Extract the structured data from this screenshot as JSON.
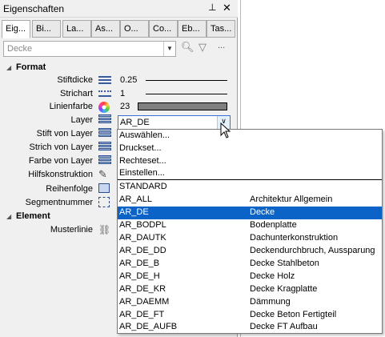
{
  "panel": {
    "title": "Eigenschaften",
    "pin_glyph": "⊥",
    "close_glyph": "✕",
    "tabs": [
      "Eig...",
      "Bi...",
      "La...",
      "As...",
      "O...",
      "Co...",
      "Eb...",
      "Tas..."
    ],
    "active_tab_index": 0,
    "filter_placeholder": "Decke",
    "tools": {
      "find_icon": "magnifier-icon",
      "filter_icon": "funnel-icon",
      "more_label": "..."
    }
  },
  "groups": {
    "format": "Format",
    "element": "Element"
  },
  "properties": {
    "stiftdicke": {
      "label": "Stiftdicke",
      "value": "0.25",
      "icon": "line-weight-icon"
    },
    "strichart": {
      "label": "Strichart",
      "value": "1",
      "icon": "line-type-icon"
    },
    "linienfarbe": {
      "label": "Linienfarbe",
      "value": "23",
      "icon": "color-wheel-icon",
      "swatch": "#808080"
    },
    "layer": {
      "label": "Layer",
      "value": "AR_DE",
      "icon": "layers-icon"
    },
    "stift_von_layer": {
      "label": "Stift von Layer",
      "icon": "layers-pen-icon"
    },
    "strich_von_layer": {
      "label": "Strich von Layer",
      "icon": "layers-stroke-icon"
    },
    "farbe_von_layer": {
      "label": "Farbe von Layer",
      "icon": "layers-color-icon"
    },
    "hilfskonstruktion": {
      "label": "Hilfskonstruktion",
      "icon": "pencil-icon"
    },
    "reihenfolge": {
      "label": "Reihenfolge",
      "icon": "order-icon"
    },
    "segmentnummer": {
      "label": "Segmentnummer",
      "icon": "segment-icon"
    },
    "musterlinie": {
      "label": "Musterlinie",
      "icon": "pattern-line-icon"
    }
  },
  "popup": {
    "menu": [
      "Auswählen...",
      "Druckset...",
      "Rechteset...",
      "Einstellen..."
    ],
    "layers": [
      {
        "code": "STANDARD",
        "desc": ""
      },
      {
        "code": "AR_ALL",
        "desc": "Architektur Allgemein"
      },
      {
        "code": "AR_DE",
        "desc": "Decke"
      },
      {
        "code": "AR_BODPL",
        "desc": "Bodenplatte"
      },
      {
        "code": "AR_DAUTK",
        "desc": "Dachunterkonstruktion"
      },
      {
        "code": "AR_DE_DD",
        "desc": "Deckendurchbruch, Aussparung"
      },
      {
        "code": "AR_DE_B",
        "desc": "Decke Stahlbeton"
      },
      {
        "code": "AR_DE_H",
        "desc": "Decke Holz"
      },
      {
        "code": "AR_DE_KR",
        "desc": "Decke Kragplatte"
      },
      {
        "code": "AR_DAEMM",
        "desc": "Dämmung"
      },
      {
        "code": "AR_DE_FT",
        "desc": "Decke Beton Fertigteil"
      },
      {
        "code": "AR_DE_AUFB",
        "desc": "Decke FT Aufbau"
      }
    ],
    "selected_index": 2,
    "selection_color": "#0b63c8"
  }
}
